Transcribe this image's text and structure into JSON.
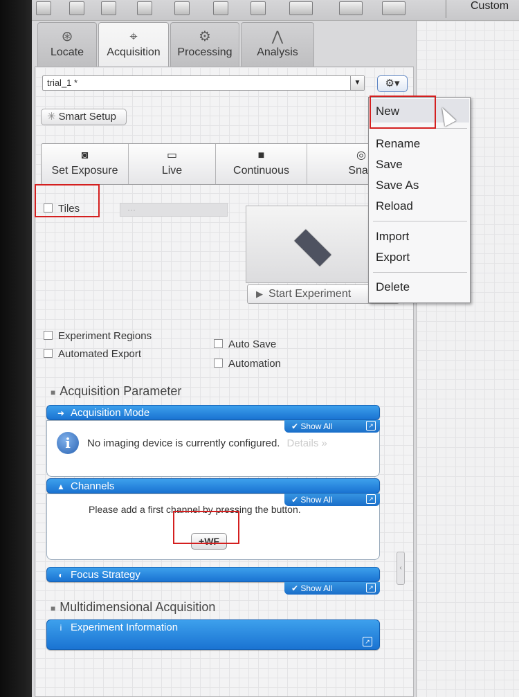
{
  "toolbar": {
    "right_label": "Custom"
  },
  "tabs": [
    {
      "label": "Locate",
      "icon": "locate-icon",
      "glyph": "⊛"
    },
    {
      "label": "Acquisition",
      "icon": "acquisition-icon",
      "glyph": "⌖"
    },
    {
      "label": "Processing",
      "icon": "processing-icon",
      "glyph": "⚙"
    },
    {
      "label": "Analysis",
      "icon": "analysis-icon",
      "glyph": "⋀"
    }
  ],
  "experiment_select": {
    "value": "trial_1 *",
    "caret": "▼"
  },
  "settings_button": {
    "label": "⚙▾"
  },
  "smart_setup": {
    "label": "Smart Setup",
    "icon": "✳"
  },
  "modes": [
    {
      "label": "Set Exposure",
      "icon": "camera-icon",
      "glyph": "◙"
    },
    {
      "label": "Live",
      "icon": "live-icon",
      "glyph": "▭"
    },
    {
      "label": "Continuous",
      "icon": "continuous-icon",
      "glyph": "■"
    },
    {
      "label": "Snap",
      "icon": "snap-icon",
      "glyph": "◎"
    }
  ],
  "tiles": {
    "label": "Tiles",
    "field": "···"
  },
  "start_experiment": {
    "label": "Start Experiment",
    "icon": "▶"
  },
  "options": {
    "experiment_regions": "Experiment Regions",
    "automated_export": "Automated Export",
    "auto_save": "Auto Save",
    "automation": "Automation"
  },
  "acquisition_parameter": {
    "label": "Acquisition Parameter"
  },
  "acquisition_mode": {
    "title": "Acquisition Mode",
    "show_all": "✔ Show All",
    "message": "No imaging device is currently configured.",
    "details": "Details »"
  },
  "channels": {
    "title": "Channels",
    "show_all": "✔ Show All",
    "message": "Please add a first channel by pressing the button.",
    "add_button": "+WF"
  },
  "focus_strategy": {
    "title": "Focus Strategy",
    "show_all": "✔ Show All"
  },
  "multidimensional": {
    "label": "Multidimensional Acquisition"
  },
  "experiment_information": {
    "title": "Experiment Information"
  },
  "menu": {
    "items": [
      "New",
      "Rename",
      "Save",
      "Save As",
      "Reload",
      "Import",
      "Export",
      "Delete"
    ]
  },
  "colors": {
    "accent_blue": "#1a73d2",
    "highlight_red": "#d41f1f"
  }
}
